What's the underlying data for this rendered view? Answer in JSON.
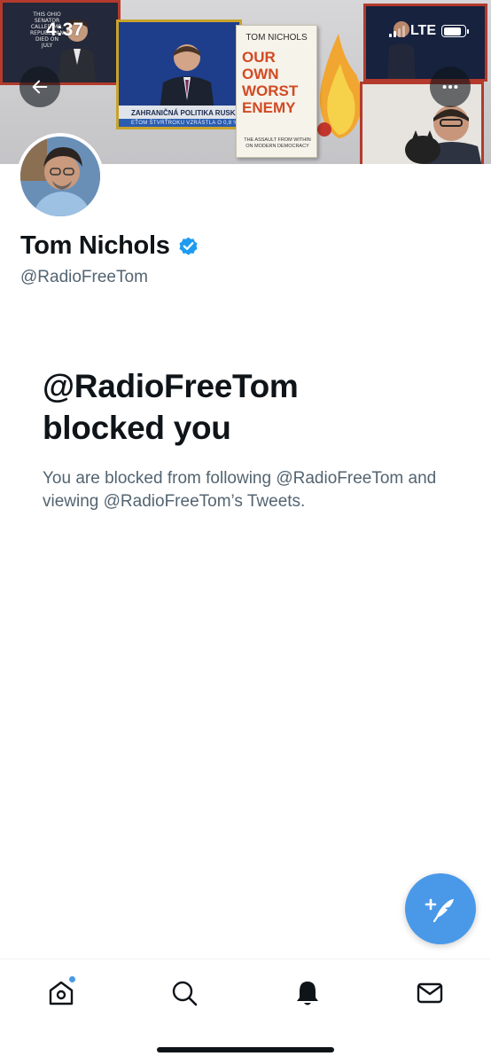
{
  "status_bar": {
    "time": "4:37",
    "network": "LTE",
    "battery_level": 0.9
  },
  "banner": {
    "book_author": "TOM NICHOLS",
    "book_title_lines": [
      "OUR OWN",
      "WORST",
      "ENEMY"
    ],
    "book_subtitle_lines": [
      "THE ASSAULT FROM WITHIN",
      "ON MODERN DEMOCRACY"
    ],
    "tv_caption": "ZAHRANIČNÁ POLITIKA RUSKA",
    "tv_ticker": "EŤOM ŠTVRŤROKU VZRÁSTLA O 0,8 %",
    "tv_left_text": "THIS OHIO SENATOR CALLED MR. REPUBLICAN DIED ON JULY"
  },
  "profile": {
    "name": "Tom Nichols",
    "handle": "@RadioFreeTom",
    "verified": true
  },
  "blocked": {
    "title_line1": "@RadioFreeTom",
    "title_line2": "blocked you",
    "description": "You are blocked from following @RadioFreeTom and viewing @RadioFreeTom’s Tweets."
  },
  "icons": {
    "back": "arrow-left-icon",
    "more": "more-horizontal-icon",
    "compose": "compose-tweet-icon",
    "home": "home-icon",
    "search": "search-icon",
    "notifications": "bell-icon",
    "messages": "envelope-icon",
    "verified": "verified-badge-icon"
  },
  "colors": {
    "accent": "#1d9bf0",
    "fab": "#4a99e9",
    "text_primary": "#0f1419",
    "text_secondary": "#536471"
  }
}
